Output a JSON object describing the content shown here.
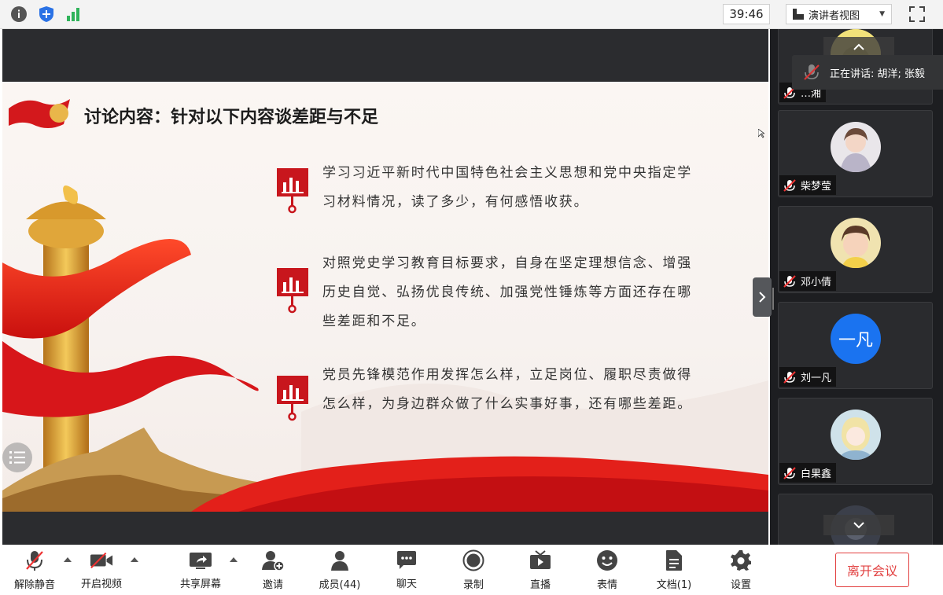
{
  "topbar": {
    "timer": "39:46",
    "view_mode": "演讲者视图",
    "icons": [
      "info-icon",
      "shield-icon",
      "signal-icon",
      "fullscreen-icon"
    ]
  },
  "slide": {
    "title": "讨论内容：针对以下内容谈差距与不足",
    "items": [
      {
        "lines": [
          "学习习近平新时代中国特色社会主义思想和党中央指定学",
          "习材料情况，读了多少，有何感悟收获。"
        ]
      },
      {
        "lines": [
          "对照党史学习教育目标要求，自身在坚定理想信念、增强",
          "历史自觉、弘扬优良传统、加强党性锤炼等方面还存在哪",
          "些差距和不足。"
        ]
      },
      {
        "lines": [
          "党员先锋模范作用发挥怎么样，立足岗位、履职尽责做得",
          "怎么样，为身边群众做了什么实事好事，还有哪些差距。"
        ]
      }
    ],
    "accent_color": "#c8161d"
  },
  "panel": {
    "speaking_label": "正在讲话: 胡洋; 张毅",
    "participants": [
      {
        "name": "…湘",
        "avatar": "photo"
      },
      {
        "name": "柴梦莹",
        "avatar": "photo"
      },
      {
        "name": "邓小倩",
        "avatar": "photo"
      },
      {
        "name": "刘一凡",
        "avatar": "text",
        "avatar_text": "一凡"
      },
      {
        "name": "白果鑫",
        "avatar": "photo"
      }
    ]
  },
  "toolbar": {
    "unmute": "解除静音",
    "start_video": "开启视频",
    "share_screen": "共享屏幕",
    "invite": "邀请",
    "members": "成员(44)",
    "chat": "聊天",
    "record": "录制",
    "live": "直播",
    "reactions": "表情",
    "docs": "文档(1)",
    "settings": "设置",
    "leave": "离开会议"
  }
}
